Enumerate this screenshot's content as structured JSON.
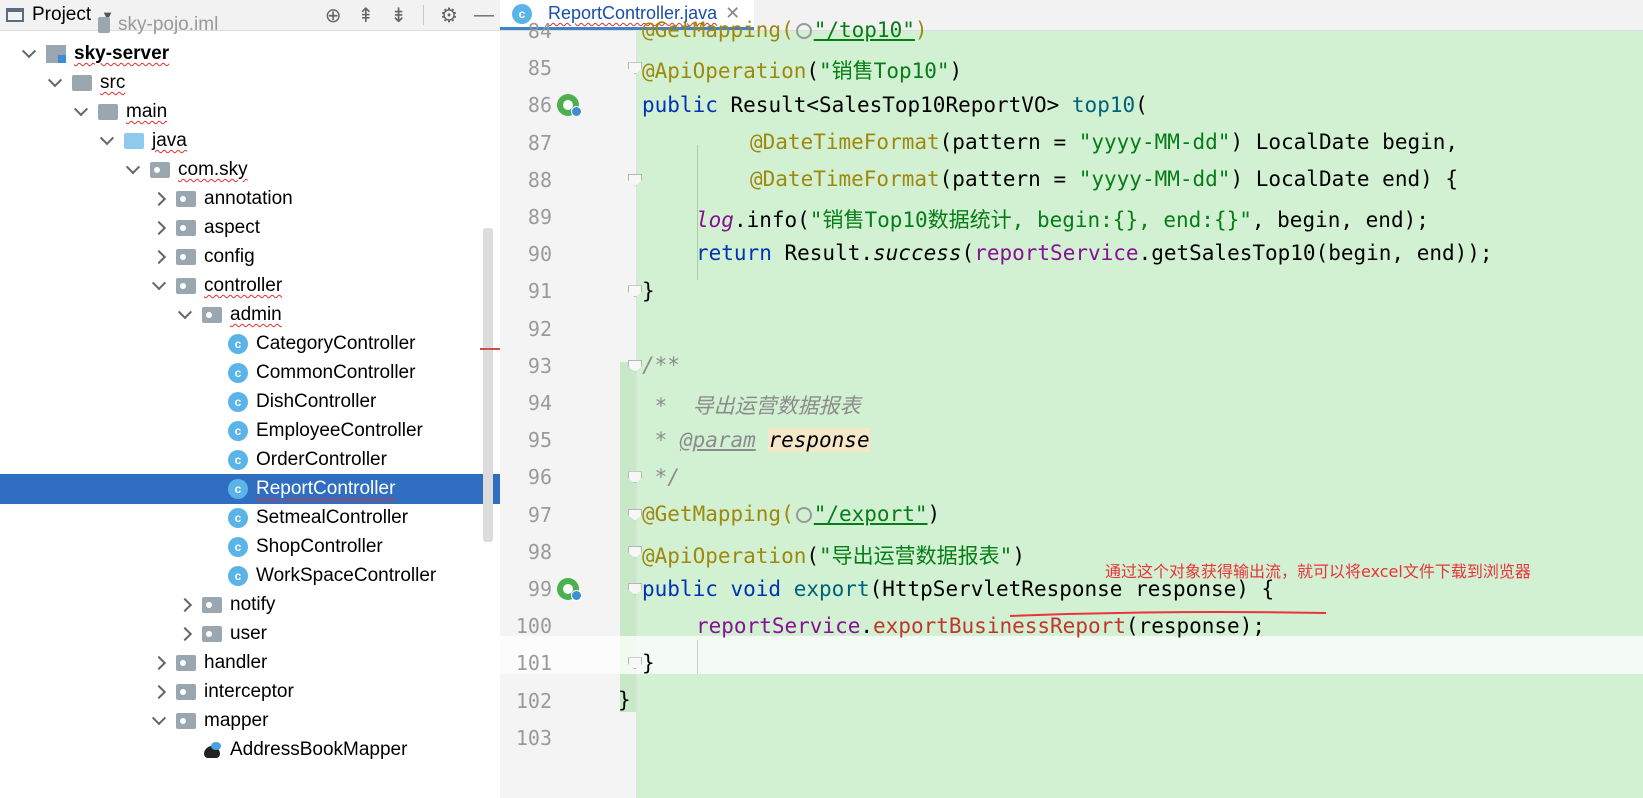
{
  "project_panel": {
    "title": "Project",
    "tree": [
      {
        "label": "sky-pojo.iml",
        "depth": 3,
        "icon": "file-icon",
        "arrow": "none",
        "partial": true
      },
      {
        "label": "sky-server",
        "depth": 1,
        "icon": "module-icon",
        "arrow": "open",
        "bold": true,
        "squiggly": true
      },
      {
        "label": "src",
        "depth": 2,
        "icon": "folder-icon",
        "arrow": "open",
        "squiggly": true
      },
      {
        "label": "main",
        "depth": 3,
        "icon": "folder-icon",
        "arrow": "open",
        "squiggly": true
      },
      {
        "label": "java",
        "depth": 4,
        "icon": "folder-blue-icon",
        "arrow": "open",
        "squiggly": true
      },
      {
        "label": "com.sky",
        "depth": 5,
        "icon": "package-icon",
        "arrow": "open",
        "squiggly": true
      },
      {
        "label": "annotation",
        "depth": 6,
        "icon": "package-icon",
        "arrow": "closed"
      },
      {
        "label": "aspect",
        "depth": 6,
        "icon": "package-icon",
        "arrow": "closed"
      },
      {
        "label": "config",
        "depth": 6,
        "icon": "package-icon",
        "arrow": "closed"
      },
      {
        "label": "controller",
        "depth": 6,
        "icon": "package-icon",
        "arrow": "open",
        "squiggly": true
      },
      {
        "label": "admin",
        "depth": 7,
        "icon": "package-icon",
        "arrow": "open",
        "squiggly": true
      },
      {
        "label": "CategoryController",
        "depth": 8,
        "icon": "class-icon",
        "arrow": "none"
      },
      {
        "label": "CommonController",
        "depth": 8,
        "icon": "class-icon",
        "arrow": "none"
      },
      {
        "label": "DishController",
        "depth": 8,
        "icon": "class-icon",
        "arrow": "none"
      },
      {
        "label": "EmployeeController",
        "depth": 8,
        "icon": "class-icon",
        "arrow": "none"
      },
      {
        "label": "OrderController",
        "depth": 8,
        "icon": "class-icon",
        "arrow": "none"
      },
      {
        "label": "ReportController",
        "depth": 8,
        "icon": "class-icon",
        "arrow": "none",
        "selected": true,
        "squiggly": true
      },
      {
        "label": "SetmealController",
        "depth": 8,
        "icon": "class-icon",
        "arrow": "none"
      },
      {
        "label": "ShopController",
        "depth": 8,
        "icon": "class-icon",
        "arrow": "none"
      },
      {
        "label": "WorkSpaceController",
        "depth": 8,
        "icon": "class-icon",
        "arrow": "none"
      },
      {
        "label": "notify",
        "depth": 7,
        "icon": "package-icon",
        "arrow": "closed"
      },
      {
        "label": "user",
        "depth": 7,
        "icon": "package-icon",
        "arrow": "closed"
      },
      {
        "label": "handler",
        "depth": 6,
        "icon": "package-icon",
        "arrow": "closed"
      },
      {
        "label": "interceptor",
        "depth": 6,
        "icon": "package-icon",
        "arrow": "closed"
      },
      {
        "label": "mapper",
        "depth": 6,
        "icon": "package-icon",
        "arrow": "open"
      },
      {
        "label": "AddressBookMapper",
        "depth": 7,
        "icon": "mapper-icon",
        "arrow": "none"
      }
    ]
  },
  "editor": {
    "tab_label": "ReportController.java",
    "lines": [
      {
        "num": "84"
      },
      {
        "num": "85"
      },
      {
        "num": "86"
      },
      {
        "num": "87"
      },
      {
        "num": "88"
      },
      {
        "num": "89"
      },
      {
        "num": "90"
      },
      {
        "num": "91"
      },
      {
        "num": "92"
      },
      {
        "num": "93"
      },
      {
        "num": "94"
      },
      {
        "num": "95"
      },
      {
        "num": "96"
      },
      {
        "num": "97"
      },
      {
        "num": "98"
      },
      {
        "num": "99"
      },
      {
        "num": "100"
      },
      {
        "num": "101"
      },
      {
        "num": "102"
      },
      {
        "num": "103"
      }
    ],
    "code": {
      "l84_ann": "@GetMapping(",
      "l84_url": "\"/top10\"",
      "l84_tail": ")",
      "l85_ann": "@ApiOperation",
      "l85_str": "\"销售Top10\"",
      "l86_kw": "public",
      "l86_type": "Result<SalesTop10ReportVO>",
      "l86_fn": "top10",
      "l87_ann": "@DateTimeFormat",
      "l87_mid": "(pattern = ",
      "l87_str": "\"yyyy-MM-dd\"",
      "l87_tail": ") LocalDate begin,",
      "l88_ann": "@DateTimeFormat",
      "l88_mid": "(pattern = ",
      "l88_str": "\"yyyy-MM-dd\"",
      "l88_tail": ") LocalDate end) {",
      "l89_fld": "log",
      "l89_mid": ".info(",
      "l89_str": "\"销售Top10数据统计, begin:{}, end:{}\"",
      "l89_tail": ", begin, end);",
      "l90_kw": "return",
      "l90_mid": " Result.",
      "l90_it": "success",
      "l90_paren": "(",
      "l90_fld": "reportService",
      "l90_tail": ".getSalesTop10(begin, end));",
      "l91": "}",
      "l93": "/**",
      "l94": " *  导出运营数据报表",
      "l95_star": " * ",
      "l95_tag": "@param",
      "l95_param": "response",
      "l96": " */",
      "l97_ann": "@GetMapping(",
      "l97_url": "\"/export\"",
      "l97_tail": ")",
      "l98_ann": "@ApiOperation",
      "l98_str": "\"导出运营数据报表\"",
      "l99_kw": "public void",
      "l99_fn": "export",
      "l99_tail": "(HttpServletResponse response) {",
      "l100_fld": "reportService",
      "l100_dot": ".",
      "l100_red": "exportBusinessReport",
      "l100_tail": "(response);",
      "l101": "}",
      "l102": "}"
    },
    "annotation_note": "通过这个对象获得输出流，就可以将excel文件下载到浏览器"
  },
  "colors": {
    "selection": "#2f6ec1",
    "code_background": "#d2f0d2",
    "annotation_red": "#e8343a"
  }
}
